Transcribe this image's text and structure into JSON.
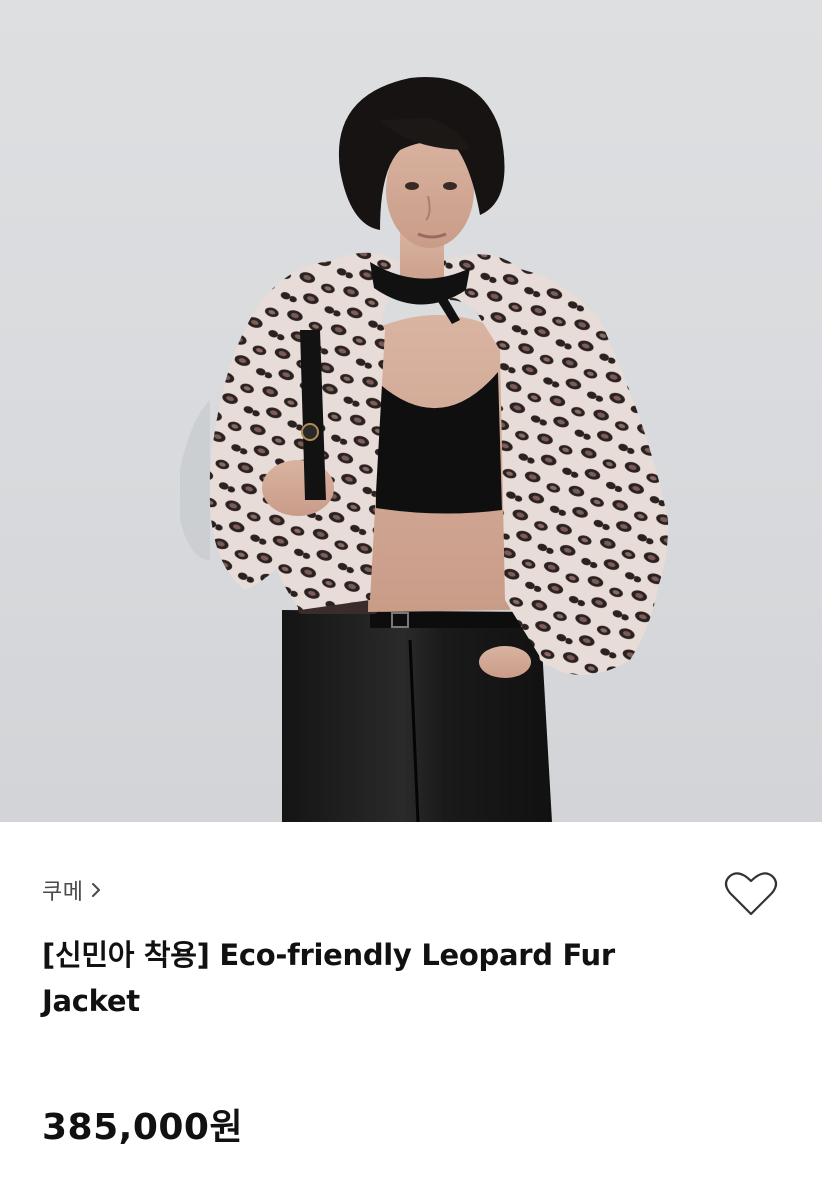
{
  "product": {
    "image_alt": "Model wearing a cropped leopard print faux fur jacket with black leather pants",
    "brand": "쿠메",
    "title": "[신민아 착용] Eco-friendly Leopard Fur Jacket",
    "price": "385,000원"
  },
  "icons": {
    "brand_chevron": "chevron-right-icon",
    "wishlist": "heart-outline-icon"
  },
  "colors": {
    "text_primary": "#111111",
    "text_secondary": "#4a4a4a",
    "background": "#ffffff",
    "photo_backdrop": "#dcdee0"
  }
}
